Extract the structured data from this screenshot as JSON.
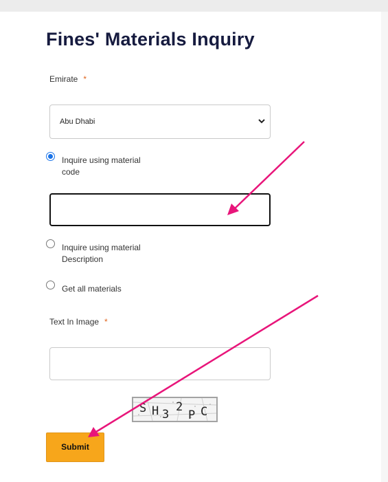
{
  "page": {
    "title": "Fines' Materials Inquiry"
  },
  "form": {
    "emirate_label": "Emirate",
    "required_marker": "*",
    "emirate_value": "Abu Dhabi",
    "radios": [
      {
        "line1": "Inquire using material",
        "line2": "code",
        "checked": true
      },
      {
        "line1": "Inquire using material",
        "line2": "Description",
        "checked": false
      },
      {
        "line1": "Get all materials",
        "line2": "",
        "checked": false
      }
    ],
    "material_code_value": "",
    "captcha_label": "Text In Image",
    "captcha_input_value": "",
    "captcha_text": "SH32PC",
    "submit_label": "Submit"
  },
  "annotation": {
    "arrow_color": "#e8157a"
  }
}
